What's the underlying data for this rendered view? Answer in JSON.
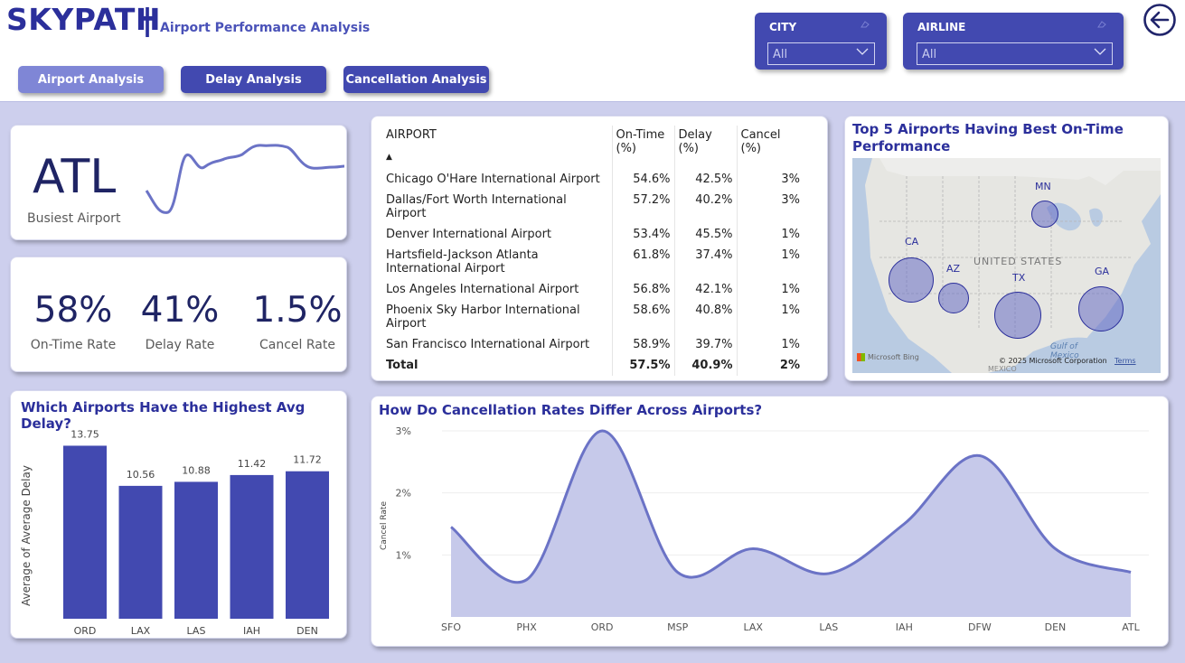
{
  "header": {
    "brand": "SKYPATH",
    "separator": "|",
    "subtitle": "Airport Performance Analysis",
    "nav": [
      {
        "label": "Airport Analysis",
        "active": true
      },
      {
        "label": "Delay Analysis",
        "active": false
      },
      {
        "label": "Cancellation Analysis",
        "active": false
      }
    ],
    "filters": [
      {
        "label": "CITY",
        "value": "All"
      },
      {
        "label": "AIRLINE",
        "value": "All"
      }
    ],
    "back_icon": "back-arrow-icon"
  },
  "colors": {
    "brand": "#2b2f9b",
    "accent": "#4249b0",
    "canvas": "#cdcfed",
    "line": "#6b73c6",
    "area": "#c6c9ea"
  },
  "kpi_busiest": {
    "code": "ATL",
    "label": "Busiest Airport"
  },
  "kpis": [
    {
      "value": "58%",
      "label": "On-Time Rate"
    },
    {
      "value": "41%",
      "label": "Delay Rate"
    },
    {
      "value": "1.5%",
      "label": "Cancel Rate"
    }
  ],
  "table": {
    "columns": [
      "AIRPORT",
      "On-Time (%)",
      "Delay (%)",
      "Cancel (%)"
    ],
    "sort_indicator": "▲",
    "rows": [
      [
        "Chicago O'Hare International Airport",
        "54.6%",
        "42.5%",
        "3%"
      ],
      [
        "Dallas/Fort Worth International Airport",
        "57.2%",
        "40.2%",
        "3%"
      ],
      [
        "Denver International Airport",
        "53.4%",
        "45.5%",
        "1%"
      ],
      [
        "Hartsfield-Jackson Atlanta International Airport",
        "61.8%",
        "37.4%",
        "1%"
      ],
      [
        "Los Angeles International Airport",
        "56.8%",
        "42.1%",
        "1%"
      ],
      [
        "Phoenix Sky Harbor International Airport",
        "58.6%",
        "40.8%",
        "1%"
      ],
      [
        "San Francisco International Airport",
        "58.9%",
        "39.7%",
        "1%"
      ]
    ],
    "total": [
      "Total",
      "57.5%",
      "40.9%",
      "2%"
    ]
  },
  "map": {
    "title": "Top 5 Airports Having Best On-Time Performance",
    "country_label": "UNITED STATES",
    "gulf_label": "Gulf of Mexico",
    "mexico_label": "MEXICO",
    "bing": "Microsoft Bing",
    "copyright": "© 2025 Microsoft Corporation",
    "terms": "Terms",
    "bubbles": [
      {
        "label": "MN"
      },
      {
        "label": "CA"
      },
      {
        "label": "AZ"
      },
      {
        "label": "TX"
      },
      {
        "label": "GA"
      }
    ]
  },
  "chart_data": [
    {
      "type": "bar",
      "title": "Which Airports Have the Highest Avg Delay?",
      "xlabel": "",
      "ylabel": "Average of Average Delay",
      "categories": [
        "ORD",
        "LAX",
        "LAS",
        "IAH",
        "DEN"
      ],
      "values": [
        13.75,
        10.56,
        10.88,
        11.42,
        11.72
      ],
      "ylim": [
        0,
        14.5
      ],
      "color": "#4249b0"
    },
    {
      "type": "area",
      "title": "How Do Cancellation Rates Differ Across Airports?",
      "xlabel": "",
      "ylabel": "Cancel Rate",
      "categories": [
        "SFO",
        "PHX",
        "ORD",
        "MSP",
        "LAX",
        "LAS",
        "IAH",
        "DFW",
        "DEN",
        "ATL"
      ],
      "values": [
        1.45,
        0.6,
        3.0,
        0.72,
        1.1,
        0.7,
        1.5,
        2.6,
        1.1,
        0.72
      ],
      "yticks": [
        "1%",
        "2%",
        "3%"
      ],
      "ylim": [
        0.5,
        3.0
      ],
      "line_color": "#6b73c6",
      "fill_color": "#c6c9ea"
    }
  ]
}
